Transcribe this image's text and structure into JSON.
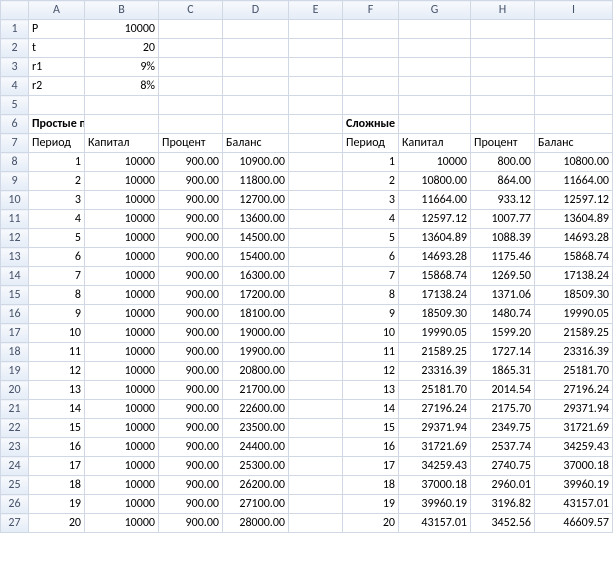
{
  "columns": [
    "A",
    "B",
    "C",
    "D",
    "E",
    "F",
    "G",
    "H",
    "I"
  ],
  "params": {
    "row1": {
      "label": "P",
      "value": "10000"
    },
    "row2": {
      "label": "t",
      "value": "20"
    },
    "row3": {
      "label": "r1",
      "value": "9%"
    },
    "row4": {
      "label": "r2",
      "value": "8%"
    }
  },
  "section_titles": {
    "simple": "Простые проценты",
    "compound": "Сложные процнты"
  },
  "headers": {
    "period": "Период",
    "capital": "Капитал",
    "percent": "Процент",
    "balance": "Баланс"
  },
  "simple": [
    {
      "period": "1",
      "capital": "10000",
      "percent": "900.00",
      "balance": "10900.00"
    },
    {
      "period": "2",
      "capital": "10000",
      "percent": "900.00",
      "balance": "11800.00"
    },
    {
      "period": "3",
      "capital": "10000",
      "percent": "900.00",
      "balance": "12700.00"
    },
    {
      "period": "4",
      "capital": "10000",
      "percent": "900.00",
      "balance": "13600.00"
    },
    {
      "period": "5",
      "capital": "10000",
      "percent": "900.00",
      "balance": "14500.00"
    },
    {
      "period": "6",
      "capital": "10000",
      "percent": "900.00",
      "balance": "15400.00"
    },
    {
      "period": "7",
      "capital": "10000",
      "percent": "900.00",
      "balance": "16300.00"
    },
    {
      "period": "8",
      "capital": "10000",
      "percent": "900.00",
      "balance": "17200.00"
    },
    {
      "period": "9",
      "capital": "10000",
      "percent": "900.00",
      "balance": "18100.00"
    },
    {
      "period": "10",
      "capital": "10000",
      "percent": "900.00",
      "balance": "19000.00"
    },
    {
      "period": "11",
      "capital": "10000",
      "percent": "900.00",
      "balance": "19900.00"
    },
    {
      "period": "12",
      "capital": "10000",
      "percent": "900.00",
      "balance": "20800.00"
    },
    {
      "period": "13",
      "capital": "10000",
      "percent": "900.00",
      "balance": "21700.00"
    },
    {
      "period": "14",
      "capital": "10000",
      "percent": "900.00",
      "balance": "22600.00"
    },
    {
      "period": "15",
      "capital": "10000",
      "percent": "900.00",
      "balance": "23500.00"
    },
    {
      "period": "16",
      "capital": "10000",
      "percent": "900.00",
      "balance": "24400.00"
    },
    {
      "period": "17",
      "capital": "10000",
      "percent": "900.00",
      "balance": "25300.00"
    },
    {
      "period": "18",
      "capital": "10000",
      "percent": "900.00",
      "balance": "26200.00"
    },
    {
      "period": "19",
      "capital": "10000",
      "percent": "900.00",
      "balance": "27100.00"
    },
    {
      "period": "20",
      "capital": "10000",
      "percent": "900.00",
      "balance": "28000.00"
    }
  ],
  "compound": [
    {
      "period": "1",
      "capital": "10000",
      "percent": "800.00",
      "balance": "10800.00"
    },
    {
      "period": "2",
      "capital": "10800.00",
      "percent": "864.00",
      "balance": "11664.00"
    },
    {
      "period": "3",
      "capital": "11664.00",
      "percent": "933.12",
      "balance": "12597.12"
    },
    {
      "period": "4",
      "capital": "12597.12",
      "percent": "1007.77",
      "balance": "13604.89"
    },
    {
      "period": "5",
      "capital": "13604.89",
      "percent": "1088.39",
      "balance": "14693.28"
    },
    {
      "period": "6",
      "capital": "14693.28",
      "percent": "1175.46",
      "balance": "15868.74"
    },
    {
      "period": "7",
      "capital": "15868.74",
      "percent": "1269.50",
      "balance": "17138.24"
    },
    {
      "period": "8",
      "capital": "17138.24",
      "percent": "1371.06",
      "balance": "18509.30"
    },
    {
      "period": "9",
      "capital": "18509.30",
      "percent": "1480.74",
      "balance": "19990.05"
    },
    {
      "period": "10",
      "capital": "19990.05",
      "percent": "1599.20",
      "balance": "21589.25"
    },
    {
      "period": "11",
      "capital": "21589.25",
      "percent": "1727.14",
      "balance": "23316.39"
    },
    {
      "period": "12",
      "capital": "23316.39",
      "percent": "1865.31",
      "balance": "25181.70"
    },
    {
      "period": "13",
      "capital": "25181.70",
      "percent": "2014.54",
      "balance": "27196.24"
    },
    {
      "period": "14",
      "capital": "27196.24",
      "percent": "2175.70",
      "balance": "29371.94"
    },
    {
      "period": "15",
      "capital": "29371.94",
      "percent": "2349.75",
      "balance": "31721.69"
    },
    {
      "period": "16",
      "capital": "31721.69",
      "percent": "2537.74",
      "balance": "34259.43"
    },
    {
      "period": "17",
      "capital": "34259.43",
      "percent": "2740.75",
      "balance": "37000.18"
    },
    {
      "period": "18",
      "capital": "37000.18",
      "percent": "2960.01",
      "balance": "39960.19"
    },
    {
      "period": "19",
      "capital": "39960.19",
      "percent": "3196.82",
      "balance": "43157.01"
    },
    {
      "period": "20",
      "capital": "43157.01",
      "percent": "3452.56",
      "balance": "46609.57"
    }
  ]
}
